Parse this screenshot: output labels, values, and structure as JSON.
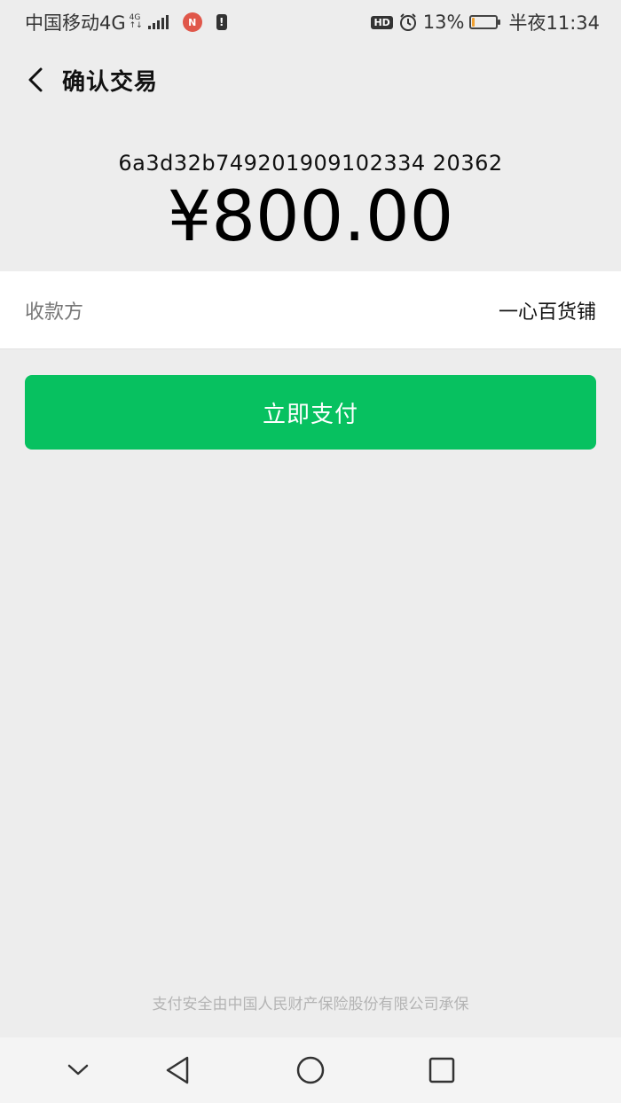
{
  "status_bar": {
    "carrier": "中国移动4G",
    "network_small_top": "4G",
    "network_small_bottom": "↑↓",
    "notification_badge": "N",
    "hd": "HD",
    "battery_percent": "13%",
    "battery_level": 0.13,
    "time": "半夜11:34"
  },
  "header": {
    "title": "确认交易"
  },
  "payment": {
    "order_id": "6a3d32b749201909102334 20362",
    "amount": "¥800.00"
  },
  "payee": {
    "label": "收款方",
    "value": "一心百货铺"
  },
  "actions": {
    "pay_label": "立即支付"
  },
  "footer": {
    "note": "支付安全由中国人民财产保险股份有限公司承保"
  },
  "colors": {
    "accent": "#07c160",
    "background": "#ededed"
  }
}
